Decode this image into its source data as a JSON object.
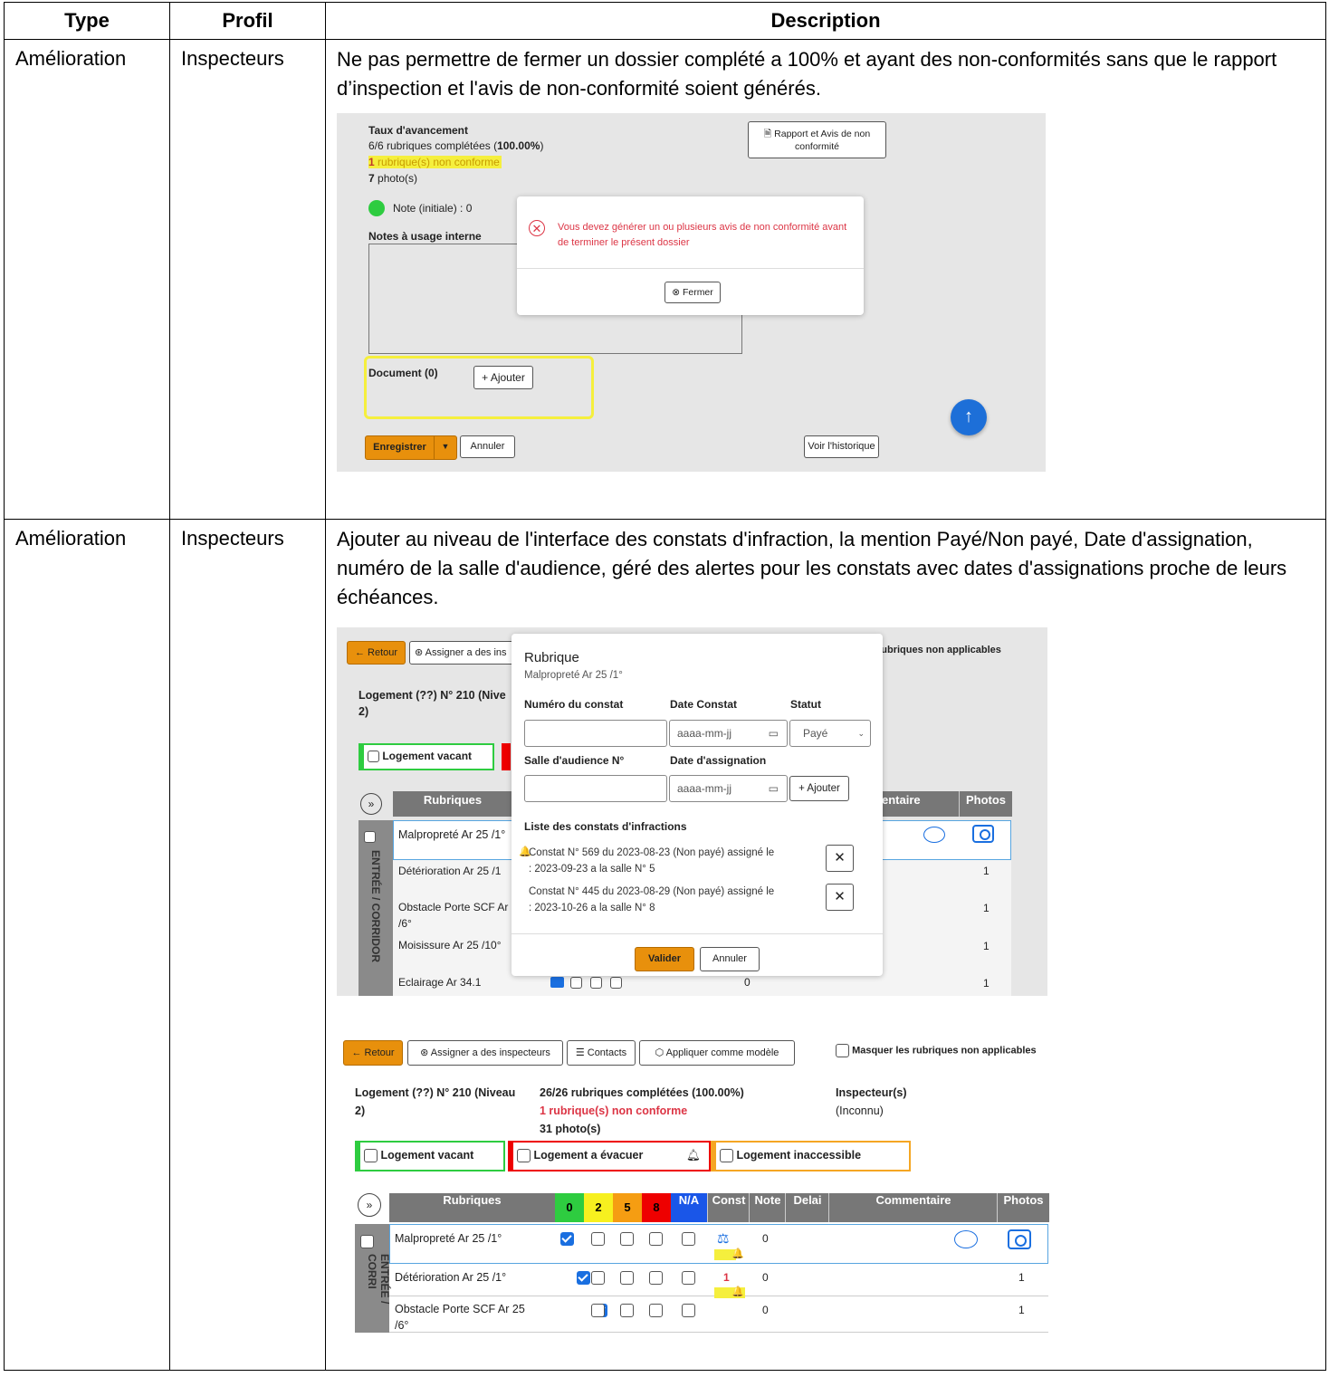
{
  "table": {
    "headers": {
      "type": "Type",
      "profil": "Profil",
      "description": "Description"
    },
    "rows": [
      {
        "type": "Amélioration",
        "profil": "Inspecteurs",
        "description": "Ne pas permettre de fermer un dossier complété a 100% et ayant des non-conformités sans que le rapport d’inspection et l'avis de non-conformité soient générés."
      },
      {
        "type": "Amélioration",
        "profil": "Inspecteurs",
        "description": "Ajouter au niveau de l'interface des constats d'infraction, la mention Payé/Non payé, Date d'assignation, numéro de la salle d'audience, géré des alertes pour les constats avec dates d'assignations proche de leurs échéances."
      }
    ]
  },
  "shot1": {
    "progress_title": "Taux d'avancement",
    "progress_line_pre": "6/6 rubriques complétées (",
    "progress_pct": "100.00%",
    "progress_line_post": ")",
    "nonconf_count": "1",
    "nonconf_text": " rubrique(s) non conforme",
    "photos_count": "7",
    "photos_text": " photo(s)",
    "note_label": "Note (initiale) : 0",
    "notes_label": "Notes à usage interne",
    "document_label": "Document (0)",
    "add_button": "+ Ajouter",
    "report_button": "Rapport et Avis de non conformité",
    "modal_message": "Vous devez générer un ou plusieurs avis de non conformité avant de terminer le présent dossier",
    "modal_close": "Fermer",
    "save_button": "Enregistrer",
    "cancel_button": "Annuler",
    "history_button": "Voir l'historique",
    "colors": {
      "highlight": "#f5ef3d",
      "save": "#e8900c",
      "error": "#dc3545",
      "green": "#2ecc40",
      "scroll": "#1d6fd8"
    }
  },
  "shot2": {
    "back_button": "Retour",
    "assign_button_partial": "Assigner a des ins",
    "hide_label_partial": "rubriques non applicables",
    "housing_label": "Logement (??) N° 210 (Nive",
    "housing_label_2": "2)",
    "vacant_label": "Logement vacant",
    "rubriques_header": "Rubriques",
    "comment_header_partial": "entaire",
    "photos_header": "Photos",
    "section_label": "ENTRÉE / CORRIDOR",
    "rows": [
      {
        "label": "Malpropreté Ar 25 /1°",
        "photos": ""
      },
      {
        "label": "Détérioration Ar 25 /1",
        "photos": "1"
      },
      {
        "label": "Obstacle Porte SCF Ar",
        "label2": "/6°",
        "photos": "1"
      },
      {
        "label": "Moisissure Ar 25 /10°",
        "photos": "1"
      },
      {
        "label": "Eclairage Ar 34.1",
        "note": "0",
        "photos": "1"
      }
    ],
    "modal": {
      "title": "Rubrique",
      "subtitle": "Malpropreté Ar 25 /1°",
      "num_label": "Numéro du constat",
      "date_label": "Date Constat",
      "status_label": "Statut",
      "date_placeholder": "aaaa-mm-jj",
      "status_value": "Payé",
      "room_label": "Salle d'audience N°",
      "assign_date_label": "Date d'assignation",
      "assign_placeholder": "aaaa-mm-jj",
      "add_button": "+ Ajouter",
      "list_title": "Liste des constats d'infractions",
      "items": [
        {
          "line1": "Constat N° 569 du 2023-08-23 (Non payé) assigné le",
          "line2": ": 2023-09-23 a la salle N° 5"
        },
        {
          "line1": "Constat N° 445 du 2023-08-29 (Non payé) assigné le",
          "line2": ": 2023-10-26 a la salle N° 8"
        }
      ],
      "validate_button": "Valider",
      "cancel_button": "Annuler"
    }
  },
  "shot3": {
    "back_button": "Retour",
    "assign_button": "Assigner a des inspecteurs",
    "contacts_button": "Contacts",
    "model_button": "Appliquer comme modèle",
    "hide_label": "Masquer les rubriques non applicables",
    "housing_label": "Logement (??) N° 210 (Niveau",
    "housing_label_2": "2)",
    "completed": "26/26 rubriques complétées (100.00%)",
    "nonconf": "1 rubrique(s) non conforme",
    "photos": "31 photo(s)",
    "inspectors_title": "Inspecteur(s)",
    "inspectors_value": "(Inconnu)",
    "vacant_label": "Logement vacant",
    "evacuate_label": "Logement a évacuer",
    "inaccessible_label": "Logement inaccessible",
    "headers": {
      "rubriques": "Rubriques",
      "c0": "0",
      "c2": "2",
      "c5": "5",
      "c8": "8",
      "na": "N/A",
      "const": "Const",
      "note": "Note",
      "delai": "Delai",
      "commentaire": "Commentaire",
      "photos": "Photos"
    },
    "section_label": "ENTRÉE / CORRI",
    "rows": [
      {
        "label": "Malpropreté Ar 25 /1°",
        "note": "0",
        "photos": ""
      },
      {
        "label": "Détérioration Ar 25 /1°",
        "const": "1",
        "note": "0",
        "photos": "1"
      },
      {
        "label": "Obstacle Porte SCF Ar 25",
        "label2": "/6°",
        "note": "0",
        "photos": "1"
      }
    ]
  }
}
